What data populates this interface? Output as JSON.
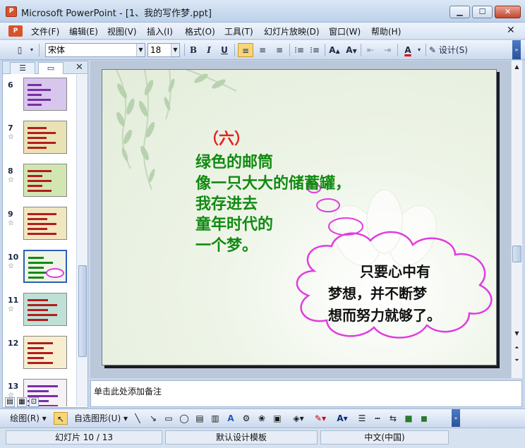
{
  "window": {
    "title": "Microsoft PowerPoint - [1、我的写作梦.ppt]",
    "min_glyph": "▁",
    "max_glyph": "☐",
    "close_glyph": "✕"
  },
  "menu": {
    "items": [
      "文件(F)",
      "编辑(E)",
      "视图(V)",
      "插入(I)",
      "格式(O)",
      "工具(T)",
      "幻灯片放映(D)",
      "窗口(W)",
      "帮助(H)"
    ],
    "close_glyph": "✕"
  },
  "toolbar": {
    "font_name": "宋体",
    "font_size": "18",
    "bold": "B",
    "italic": "I",
    "underline": "U",
    "design_label": "设计(S)"
  },
  "slides_pane": {
    "close_glyph": "✕",
    "slides": [
      {
        "number": "6",
        "starred": false,
        "selected": false
      },
      {
        "number": "7",
        "starred": true,
        "selected": false
      },
      {
        "number": "8",
        "starred": true,
        "selected": false
      },
      {
        "number": "9",
        "starred": true,
        "selected": false
      },
      {
        "number": "10",
        "starred": true,
        "selected": true
      },
      {
        "number": "11",
        "starred": true,
        "selected": false
      },
      {
        "number": "12",
        "starred": false,
        "selected": false
      },
      {
        "number": "13",
        "starred": true,
        "selected": false
      }
    ],
    "star_glyph": "☆"
  },
  "slide": {
    "heading": "（六）",
    "lines": [
      "绿色的邮筒",
      "像一只大大的储蓄罐，",
      "我存进去",
      "童年时代的",
      "一个梦。"
    ],
    "cloud_lines": [
      "只要心中有",
      "梦想，并不断梦",
      "想而努力就够了。"
    ],
    "text_color": "#118a11",
    "heading_color": "#e42222",
    "cloud_stroke": "#e23be2"
  },
  "notes": {
    "placeholder": "单击此处添加备注"
  },
  "drawing_toolbar": {
    "draw_label": "绘图(R)",
    "autoshapes_label": "自选图形(U)"
  },
  "status": {
    "slide_position": "幻灯片 10 / 13",
    "design_template": "默认设计模板",
    "language": "中文(中国)"
  }
}
